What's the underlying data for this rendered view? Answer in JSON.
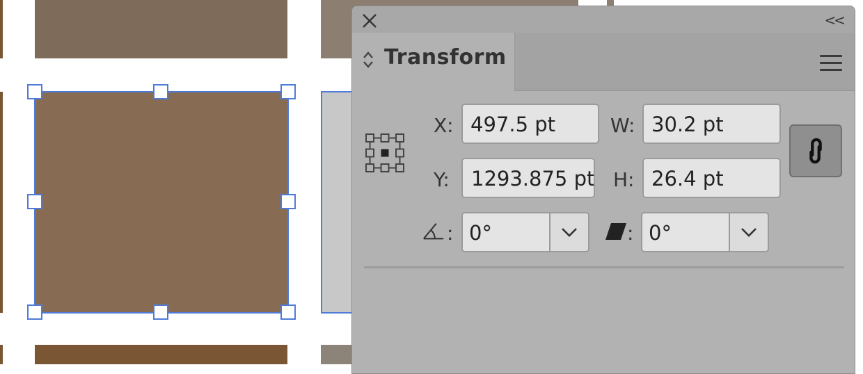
{
  "canvas": {
    "swatch_colors": {
      "top_left": "#7f6b5a",
      "top_right": "#8c7f72",
      "selected": "#876b52",
      "bottom_left": "#7b5634",
      "bottom_right": "#8c8478"
    },
    "selection_color": "#4f7bd8"
  },
  "panel": {
    "close_icon": "close-icon",
    "collapse_label": "<<",
    "tab_label": "Transform",
    "menu_icon": "hamburger-menu-icon",
    "reference_point_icon": "reference-point-icon",
    "x_label": "X:",
    "x_value": "497.5 pt",
    "y_label": "Y:",
    "y_value": "1293.875 pt",
    "w_label": "W:",
    "w_value": "30.2 pt",
    "h_label": "H:",
    "h_value": "26.4 pt",
    "constrain_icon": "link-icon",
    "rotate_icon": "rotate-angle-icon",
    "rotate_sep": ":",
    "rotate_value": "0°",
    "shear_icon": "shear-icon",
    "shear_sep": ":",
    "shear_value": "0°"
  }
}
